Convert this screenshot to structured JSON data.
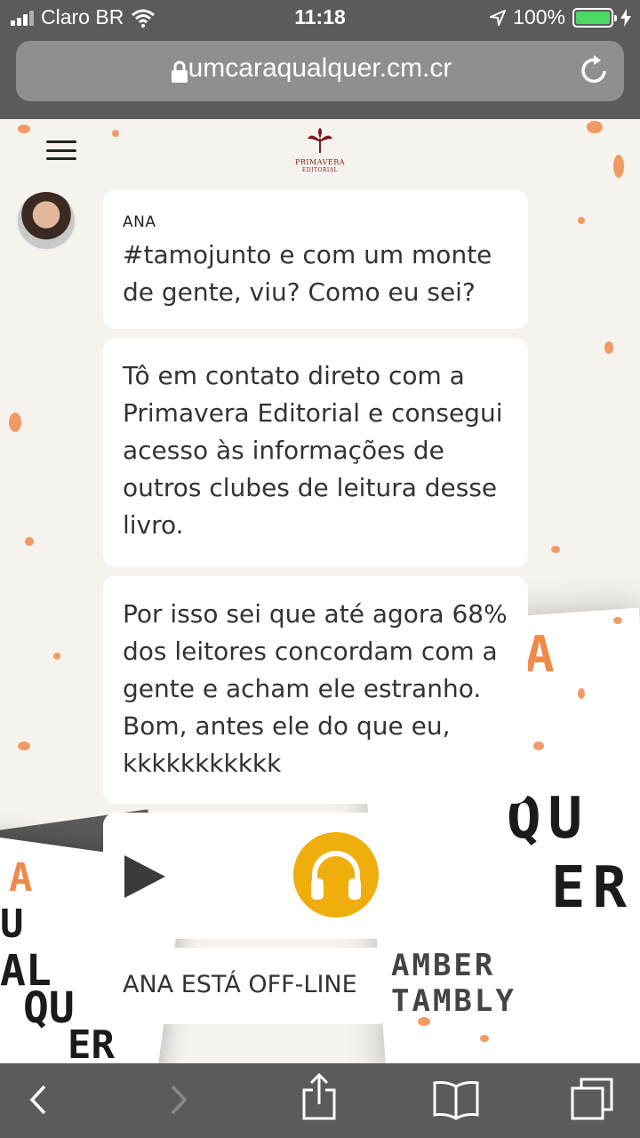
{
  "status_bar": {
    "carrier": "Claro BR",
    "time": "11:18",
    "battery_percent": "100%"
  },
  "browser": {
    "url": "umcaraqualquer.cm.cr"
  },
  "header": {
    "logo_line1": "PRIMAVERA",
    "logo_line2": "EDITORIAL"
  },
  "chat": {
    "sender": "ANA",
    "messages": [
      "#tamojunto e com um monte de gente, viu? Como eu sei?",
      "Tô em contato direto com a Primavera Editorial e consegui acesso às informações de outros clubes de leitura desse livro.",
      "Por isso sei que até agora 68% dos leitores concordam com a gente e acham ele estranho. Bom, antes ele do que eu, kkkkkkkkkkk"
    ],
    "status": "ANA ESTÁ OFF-LINE"
  },
  "background_text": {
    "cover_q": "QU",
    "cover_e": "ER",
    "author": "AMBER TAMBLY",
    "left_a": "A",
    "left_u": "U",
    "left_al": "AL",
    "left_qu": "QU",
    "left_er": "ER",
    "left_a2": "A"
  },
  "colors": {
    "chrome": "#5b5b5b",
    "accent_orange": "#f08a4b",
    "audio_button": "#f0ae0c",
    "battery": "#4cd964"
  },
  "icons": {
    "menu": "hamburger-icon",
    "audio": "headphones-icon",
    "play": "play-icon",
    "lock": "lock-icon",
    "reload": "reload-icon",
    "back": "back-icon",
    "forward": "forward-icon",
    "share": "share-icon",
    "bookmarks": "bookmarks-icon",
    "tabs": "tabs-icon"
  }
}
